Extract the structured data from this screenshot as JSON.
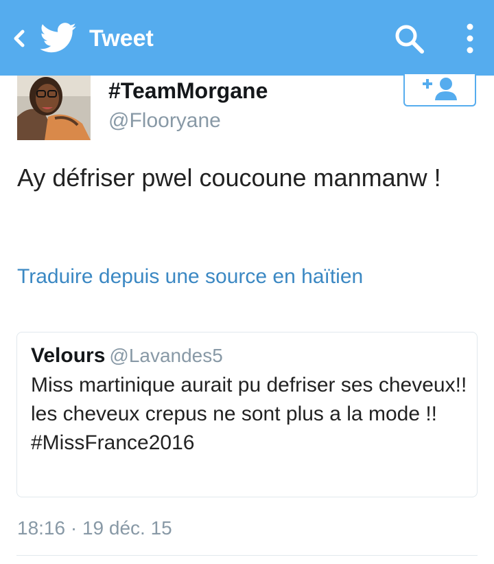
{
  "topbar": {
    "title": "Tweet",
    "icons": {
      "back": "chevron-left-icon",
      "logo": "twitter-bird-icon",
      "search": "search-icon",
      "more": "more-vertical-icon"
    },
    "color": "#55acee"
  },
  "tweet": {
    "author": {
      "display_name": "#TeamMorgane",
      "handle": "@Flooryane"
    },
    "follow_icon": "add-user-icon",
    "text": "Ay défriser pwel coucoune manmanw !",
    "translate_link": "Traduire depuis une source en haïtien",
    "quoted": {
      "name": "Velours",
      "handle": "@Lavandes5",
      "text": "Miss martinique aurait pu defriser ses cheveux!!  les cheveux crepus ne sont plus a la mode !!\n#MissFrance2016"
    },
    "timestamp": "18:16 · 19 déc. 15"
  },
  "colors": {
    "accent": "#55acee",
    "link": "#3b88c3",
    "muted": "#8899a6",
    "text": "#222222"
  }
}
